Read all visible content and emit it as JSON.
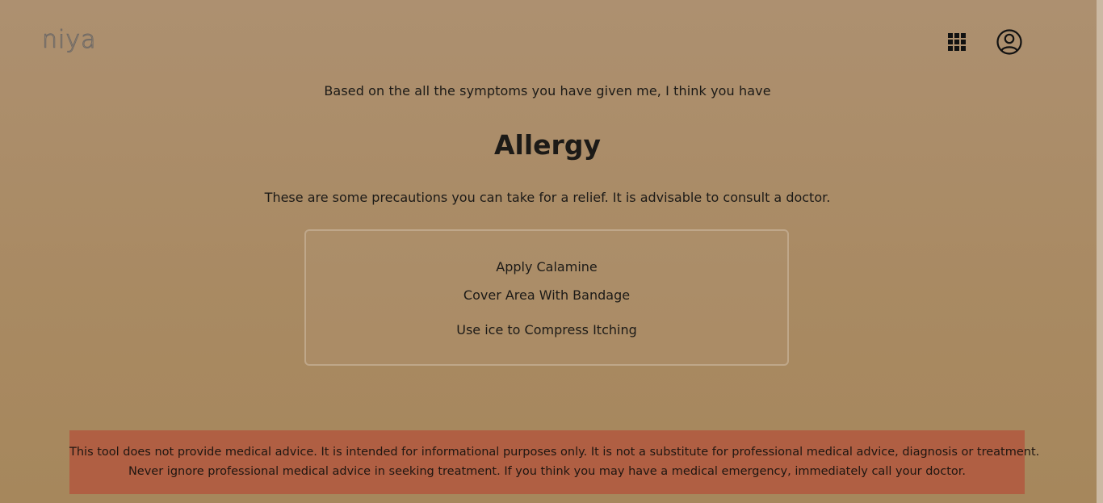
{
  "header": {
    "logo_text": "niya",
    "apps_icon": "grid-icon",
    "profile_icon": "user-circle-icon"
  },
  "result": {
    "intro": "Based on the all the symptoms you have given me, I think you have",
    "diagnosis": "Allergy",
    "advice": "These are some precautions you can take for a relief. It is advisable to consult a doctor."
  },
  "precautions": [
    "Apply Calamine",
    "Cover Area With Bandage",
    "Use ice to Compress Itching"
  ],
  "disclaimer": {
    "line1": "This tool does not provide medical advice. It is intended for informational purposes only. It is not a substitute for professional medical advice, diagnosis or treatment.",
    "line2": "Never ignore professional medical advice in seeking treatment. If you think you may have a medical emergency, immediately call your doctor."
  },
  "colors": {
    "background": "#ad9070",
    "disclaimer_bg": "#b05f43",
    "text": "#1c1a17"
  }
}
